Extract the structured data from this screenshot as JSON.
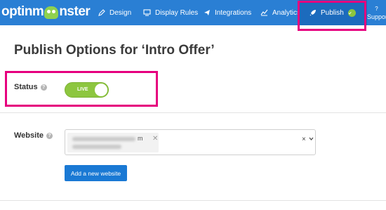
{
  "logo": {
    "text_before": "optinm",
    "text_after": "nster"
  },
  "nav": {
    "design": "Design",
    "display_rules": "Display Rules",
    "integrations": "Integrations",
    "analytics": "Analytics",
    "publish": "Publish",
    "support_icon": "?",
    "support": "Support"
  },
  "page": {
    "title": "Publish Options for ‘Intro Offer’"
  },
  "status": {
    "label": "Status",
    "toggle_text": "LIVE",
    "is_live": true
  },
  "website": {
    "label": "Website",
    "tag_suffix": "m",
    "tag_remove": "✕",
    "clear": "×",
    "add_button": "Add a new website"
  },
  "colors": {
    "topbar": "#2a7fd4",
    "active_tab": "#1c6bbd",
    "live_green": "#8dc63f",
    "highlight": "#e6007e",
    "button": "#1a79d4"
  }
}
